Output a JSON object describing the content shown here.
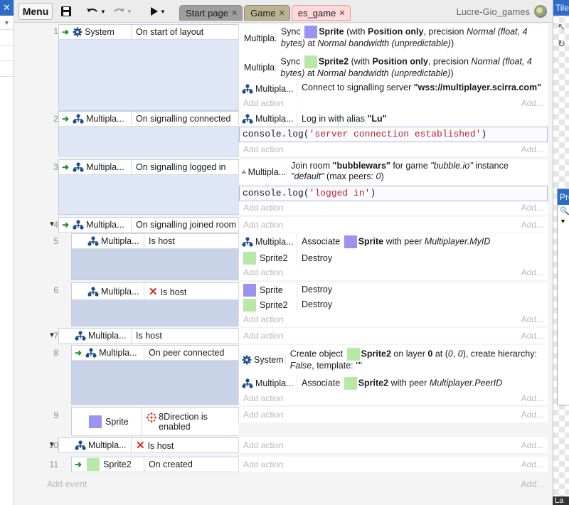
{
  "toolbar": {
    "menu_label": "Menu",
    "tabs": [
      {
        "label": "Start page"
      },
      {
        "label": "Game"
      },
      {
        "label": "es_game"
      }
    ],
    "user": "Lucre-Gio_games",
    "icons": [
      "save-icon",
      "undo-icon",
      "redo-icon",
      "play-icon"
    ]
  },
  "right_panel": {
    "tile_header": "Tile",
    "properties_header": "Pro",
    "bottom_tab": "La"
  },
  "add_action": "Add action",
  "add_more": "Add...",
  "add_event": "Add event",
  "events": [
    {
      "num": "1",
      "cond_obj": "System",
      "cond": "On start of layout",
      "actions": [
        {
          "obj": "Multipla...",
          "pre": "Sync",
          "obj2": "Sprite",
          "mid": "(with",
          "b1": "Position only",
          "mid2": ", precision",
          "i1": "Normal (float, 4 bytes)",
          "mid3": "at",
          "i2": "Normal bandwidth (unpredictable)",
          "end": ")"
        },
        {
          "obj": "Multipla...",
          "pre": "Sync",
          "obj2": "Sprite2",
          "mid": "(with",
          "b1": "Position only",
          "mid2": ", precision",
          "i1": "Normal (float, 4 bytes)",
          "mid3": "at",
          "i2": "Normal bandwidth (unpredictable)",
          "end": ")"
        },
        {
          "obj": "Multipla...",
          "pre": "Connect to signalling server",
          "b1": "\"wss://multiplayer.scirra.com\""
        }
      ]
    },
    {
      "num": "2",
      "cond_obj": "Multipla...",
      "cond": "On signalling connected",
      "actions": [
        {
          "obj": "Multipla...",
          "pre": "Log in with alias",
          "b1": "\"Lu\""
        }
      ],
      "js_fn": "console.log(",
      "js_str": "'server connection established'",
      "js_end": ")"
    },
    {
      "num": "3",
      "cond_obj": "Multipla...",
      "cond": "On signalling logged in",
      "actions": [
        {
          "obj": "Multipla...",
          "pre": "Join room",
          "b1": "\"bubblewars\"",
          "mid": "for game",
          "i1": "\"bubble.io\"",
          "mid2": "instance",
          "i2": "\"default\"",
          "mid3": "(max peers:",
          "i3": "0",
          "end": ")"
        }
      ],
      "js_fn": "console.log(",
      "js_str": "'logged in'",
      "js_end": ")"
    },
    {
      "num": "4",
      "cond_obj": "Multipla...",
      "cond": "On signalling joined room"
    },
    {
      "num": "5",
      "cond_obj": "Multipla...",
      "cond": "Is host",
      "actions": [
        {
          "obj": "Multipla...",
          "pre": "Associate",
          "obj2": "Sprite",
          "mid": "with peer",
          "i1": "Multiplayer.MyID"
        },
        {
          "obj": "Sprite2",
          "pre": "Destroy"
        }
      ]
    },
    {
      "num": "6",
      "cond_obj": "Multipla...",
      "cond": "Is host",
      "actions": [
        {
          "obj": "Sprite",
          "pre": "Destroy"
        },
        {
          "obj": "Sprite2",
          "pre": "Destroy"
        }
      ]
    },
    {
      "num": "7",
      "cond_obj": "Multipla...",
      "cond": "Is host"
    },
    {
      "num": "8",
      "cond_obj": "Multipla...",
      "cond": "On peer connected",
      "actions": [
        {
          "obj": "System",
          "pre": "Create object",
          "obj2": "Sprite2",
          "mid": "on layer",
          "b1": "0",
          "mid2": "at (",
          "i1": "0",
          "mid3": ",",
          "i2": "0",
          "mid4": "), create hierarchy:",
          "i3": "False",
          "mid5": ", template:",
          "i4": "\"\""
        },
        {
          "obj": "Multipla...",
          "pre": "Associate",
          "obj2": "Sprite2",
          "mid": "with peer",
          "i1": "Multiplayer.PeerID"
        }
      ]
    },
    {
      "num": "9",
      "cond_obj": "Sprite",
      "cond": "8Direction is enabled"
    },
    {
      "num": "10",
      "cond_obj": "Multipla...",
      "cond": "Is host"
    },
    {
      "num": "11",
      "cond_obj": "Sprite2",
      "cond": "On created"
    }
  ]
}
